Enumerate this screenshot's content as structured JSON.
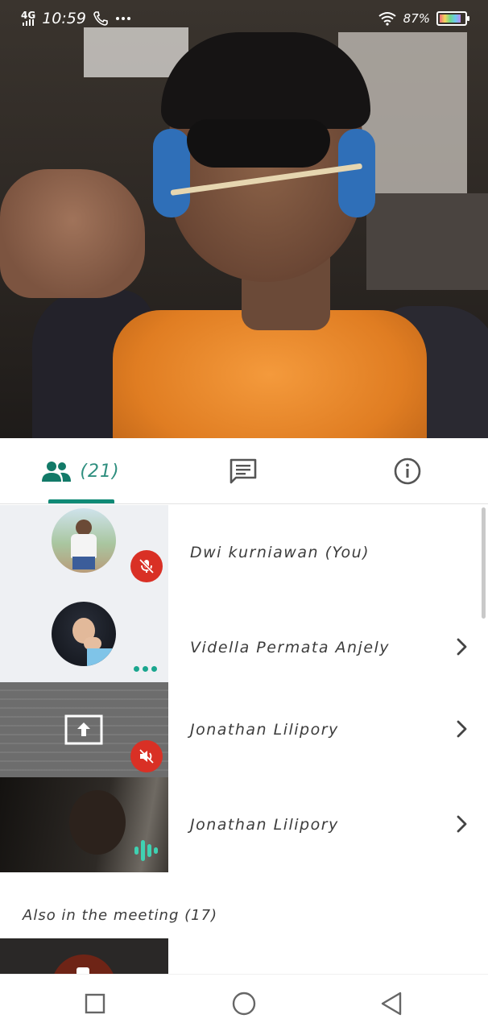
{
  "status_bar": {
    "network": "4G",
    "time": "10:59",
    "battery_percent": "87%"
  },
  "tabs": {
    "people_count": "(21)",
    "active": "people"
  },
  "participants": [
    {
      "name": "Dwi kurniawan (You)",
      "status": "muted"
    },
    {
      "name": "Vidella Permata Anjely",
      "status": "more-options"
    },
    {
      "name": "Jonathan Lilipory",
      "status": "presenting-muted"
    },
    {
      "name": "Jonathan Lilipory",
      "status": "speaking"
    }
  ],
  "also_in_meeting": "Also in the meeting (17)",
  "colors": {
    "accent": "#0f8a76",
    "mute_red": "#d93025",
    "speaking_green": "#1aa68e"
  }
}
